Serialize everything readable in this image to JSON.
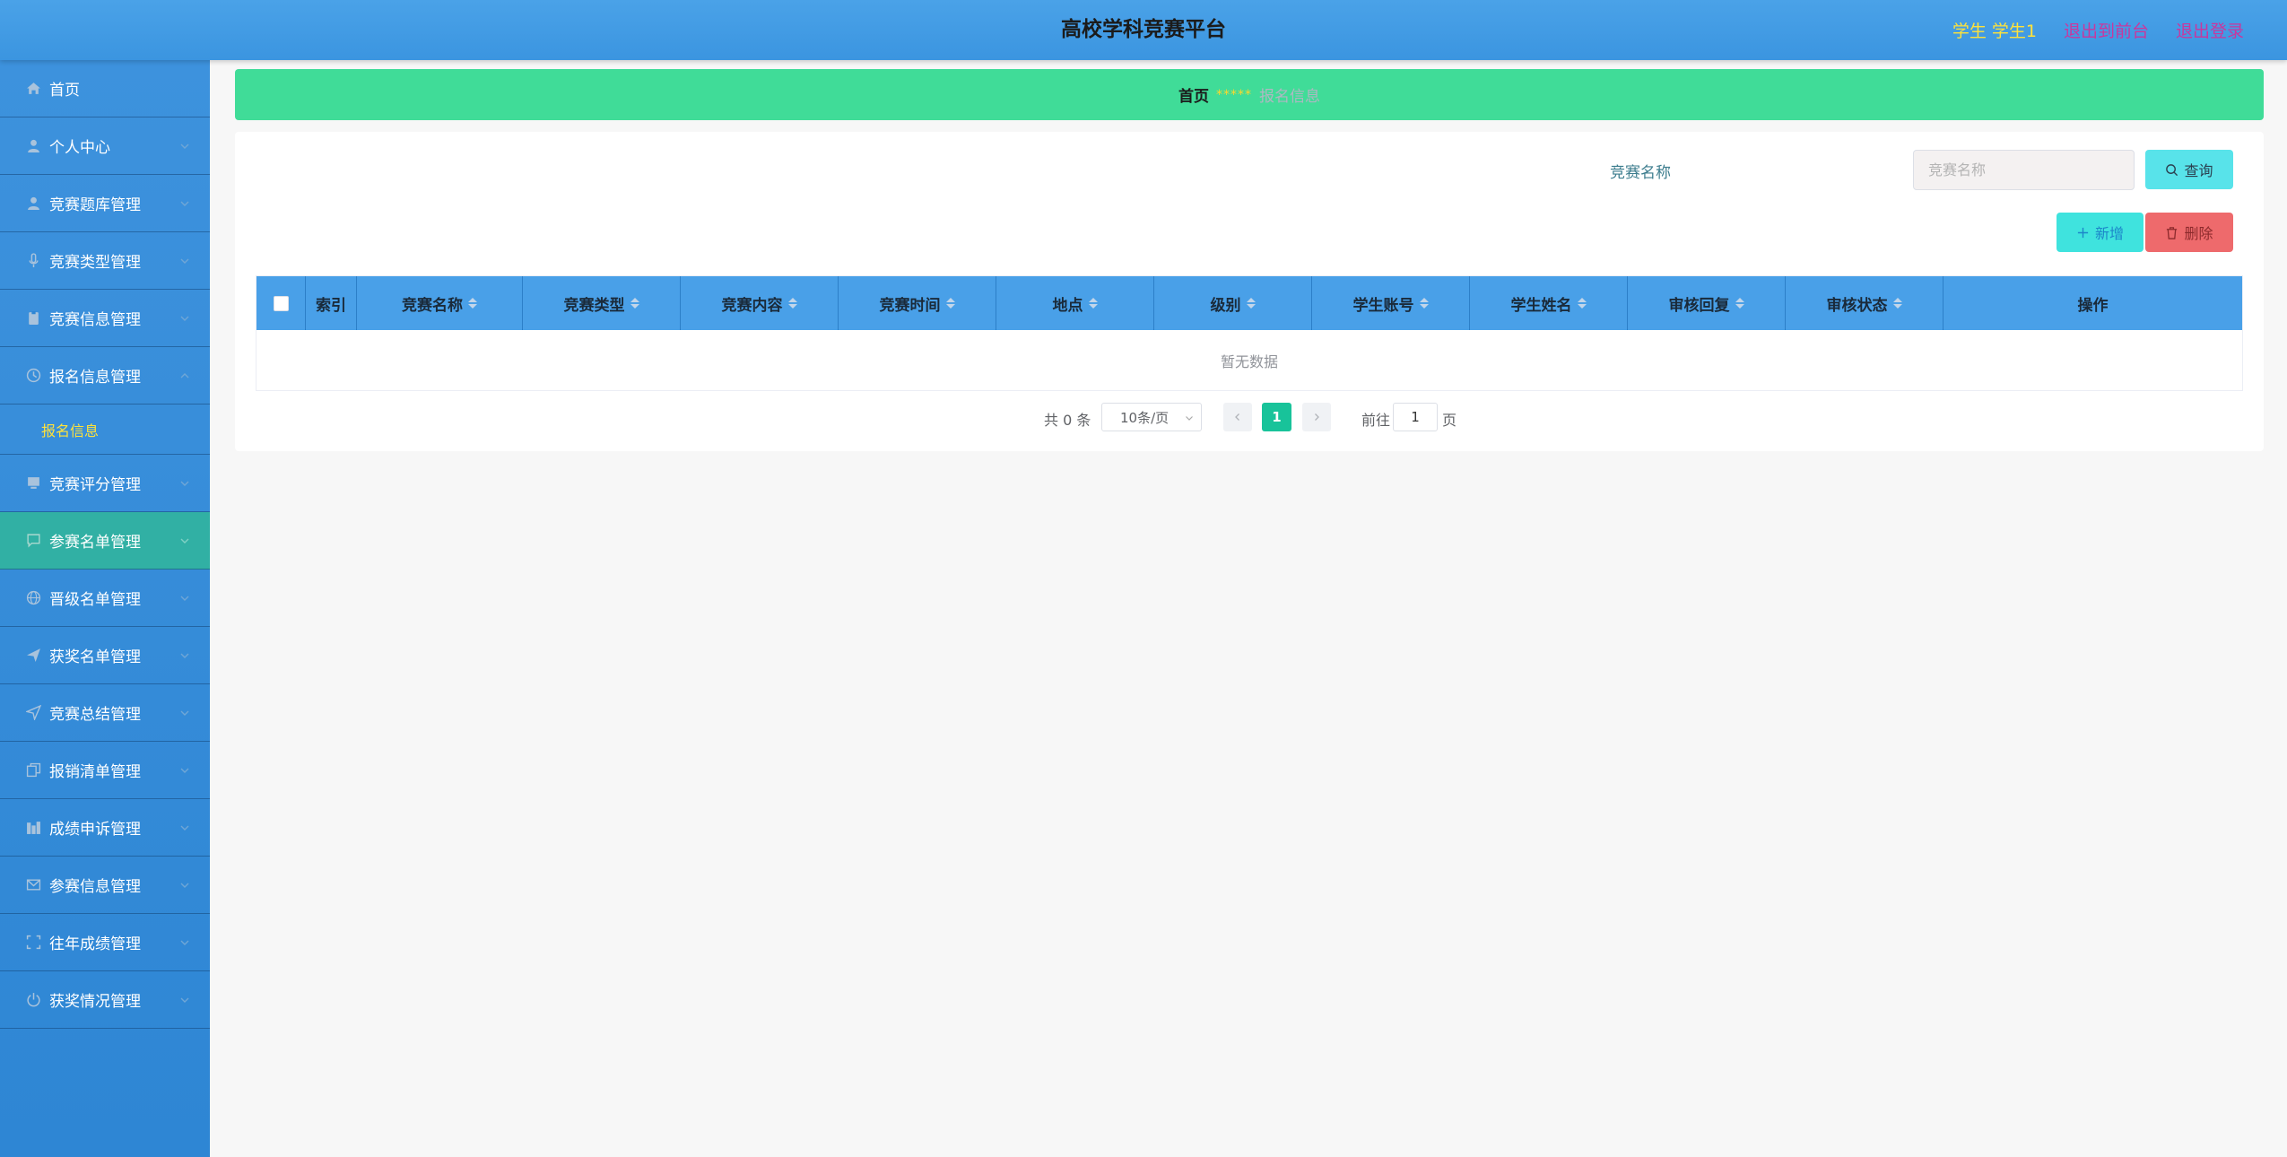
{
  "header": {
    "title": "高校学科竞赛平台",
    "user": "学生 学生1",
    "exit_front": "退出到前台",
    "logout": "退出登录"
  },
  "sidebar": {
    "items": [
      {
        "label": "首页",
        "icon": "home-icon"
      },
      {
        "label": "个人中心",
        "icon": "user-icon"
      },
      {
        "label": "竞赛题库管理",
        "icon": "user-icon"
      },
      {
        "label": "竞赛类型管理",
        "icon": "microphone-icon"
      },
      {
        "label": "竞赛信息管理",
        "icon": "clipboard-icon"
      },
      {
        "label": "报名信息管理",
        "icon": "clock-icon"
      },
      {
        "label": "竞赛评分管理",
        "icon": "monitor-icon"
      },
      {
        "label": "参赛名单管理",
        "icon": "message-icon"
      },
      {
        "label": "晋级名单管理",
        "icon": "globe-icon"
      },
      {
        "label": "获奖名单管理",
        "icon": "send-icon"
      },
      {
        "label": "竞赛总结管理",
        "icon": "location-icon"
      },
      {
        "label": "报销清单管理",
        "icon": "copy-icon"
      },
      {
        "label": "成绩申诉管理",
        "icon": "chart-icon"
      },
      {
        "label": "参赛信息管理",
        "icon": "mail-icon"
      },
      {
        "label": "往年成绩管理",
        "icon": "fullscreen-icon"
      },
      {
        "label": "获奖情况管理",
        "icon": "power-icon"
      }
    ],
    "sub_item": "报名信息",
    "active_item": "参赛名单管理"
  },
  "breadcrumb": {
    "home": "首页",
    "separator": "*****",
    "current": "报名信息"
  },
  "search": {
    "label": "竞赛名称",
    "placeholder": "竞赛名称",
    "query_button": "查询"
  },
  "actions": {
    "add": "新增",
    "delete": "删除"
  },
  "table": {
    "columns": [
      "索引",
      "竞赛名称",
      "竞赛类型",
      "竞赛内容",
      "竞赛时间",
      "地点",
      "级别",
      "学生账号",
      "学生姓名",
      "审核回复",
      "审核状态",
      "操作"
    ],
    "empty_text": "暂无数据"
  },
  "pagination": {
    "total": "共 0 条",
    "page_size": "10条/页",
    "current_page": "1",
    "goto_label": "前往",
    "goto_value": "1",
    "goto_suffix": "页"
  },
  "colors": {
    "header": "#4aa2e8",
    "sidebar": "#3d92dd",
    "breadcrumb": "#40dc98",
    "table_header": "#49a0e8",
    "active_menu": "#31b0a4",
    "page_active": "#18c39a"
  }
}
